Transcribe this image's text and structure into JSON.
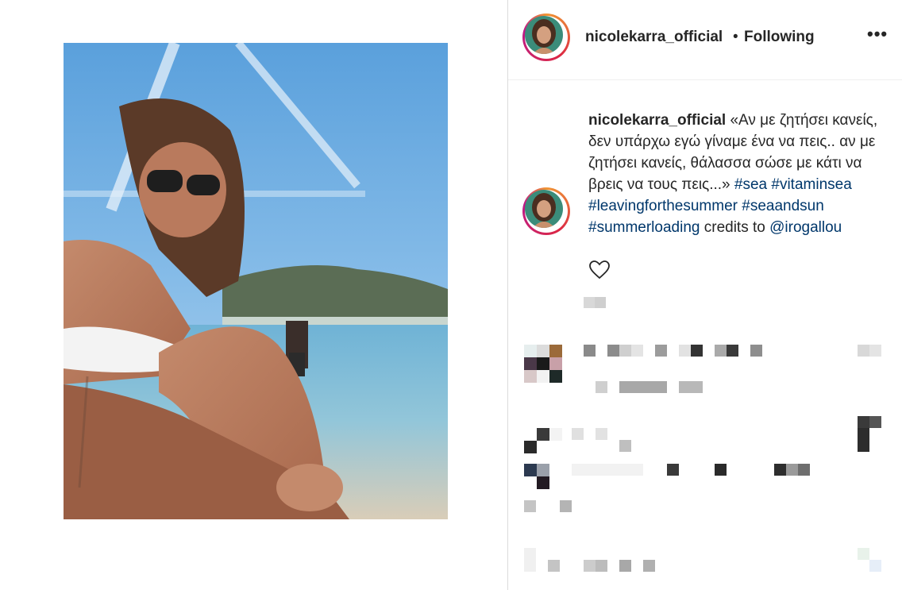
{
  "post": {
    "username": "nicolekarra_official",
    "separator": "•",
    "follow_status": "Following",
    "more_label": "•••"
  },
  "caption": {
    "username": "nicolekarra_official",
    "text": "«Αν με ζητήσει κανείς, δεν υπάρχω εγώ γίναμε ένα να πεις.. αν με ζητήσει κανείς, θάλασσα σώσε με κάτι να βρεις να τους πεις...»",
    "hashtags": [
      "#sea",
      "#vitaminsea",
      "#leavingforthesummer",
      "#seaandsun",
      "#summerloading"
    ],
    "credits_text": "credits to",
    "mention": "@irogallou"
  },
  "icons": {
    "more": "more-options-icon",
    "like": "heart-icon"
  },
  "colors": {
    "hashtag": "#00376b",
    "text": "#262626",
    "divider": "#dbdbdb"
  }
}
